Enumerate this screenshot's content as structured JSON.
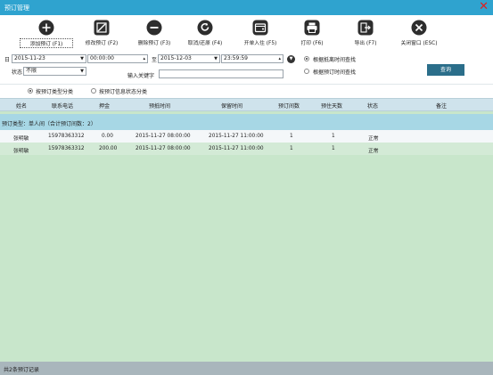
{
  "window": {
    "title": "预订管理"
  },
  "toolbar": [
    {
      "label": "添加预订 (F1)",
      "icon": "plus-circle-icon"
    },
    {
      "label": "修改预订 (F2)",
      "icon": "edit-box-icon"
    },
    {
      "label": "删除预订 (F3)",
      "icon": "minus-circle-icon"
    },
    {
      "label": "取消/还原 (F4)",
      "icon": "undo-circle-icon"
    },
    {
      "label": "开单入住 (F5)",
      "icon": "wallet-icon"
    },
    {
      "label": "打印 (F6)",
      "icon": "printer-icon"
    },
    {
      "label": "导出 (F7)",
      "icon": "export-icon"
    },
    {
      "label": "关闭窗口 (ESC)",
      "icon": "close-circle-icon"
    }
  ],
  "filter": {
    "date_prefix": "日",
    "start_date": "2015-11-23",
    "start_time": "00:00:00",
    "to_label": "至",
    "end_date": "2015-12-03",
    "end_time": "23:59:59",
    "status_label": "状态",
    "status_value": "不限",
    "keyword_label": "输入关键字",
    "keyword_value": "",
    "radio_arrival": "根据抵离时间查找",
    "radio_booking": "根据预订时间查找",
    "query_button": "查询"
  },
  "grouping": {
    "by_type": "按预订类型分类",
    "by_status": "按预订信息状态分类"
  },
  "table": {
    "columns": [
      "姓名",
      "联系电话",
      "押金",
      "预抵时间",
      "保留时间",
      "预订间数",
      "预住天数",
      "状态",
      "备注"
    ],
    "group_label": "预订类型：单人间（合计预订间数：2）",
    "rows": [
      [
        "张明敏",
        "15978363312",
        "0.00",
        "2015-11-27 08:00:00",
        "2015-11-27 11:00:00",
        "1",
        "1",
        "正常",
        ""
      ],
      [
        "张明敏",
        "15978363312",
        "200.00",
        "2015-11-27 08:00:00",
        "2015-11-27 11:00:00",
        "1",
        "1",
        "正常",
        ""
      ]
    ]
  },
  "status": {
    "text": "共2条预订记录"
  }
}
